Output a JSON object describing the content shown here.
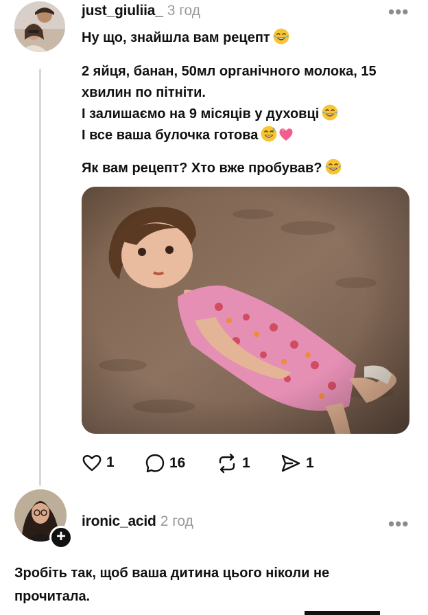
{
  "post": {
    "username": "just_giuliia_",
    "time": "3 год",
    "greeting": "Ну що, знайшла вам рецепт",
    "recipe_line_1": "2 яйця, банан, 50мл органічного молока, 15",
    "recipe_line_2": "хвилин по пітніти.",
    "recipe_line_3": "І залишаємо на 9 місяців у духовці",
    "recipe_line_4": "І все ваша булочка готова",
    "question": "Як вам рецепт? Хто вже пробував?",
    "likes": "1",
    "comments": "16",
    "reposts": "1",
    "shares": "1"
  },
  "reply": {
    "username": "ironic_acid",
    "time": "2 год",
    "text_line_1": "Зробіть так, щоб ваша дитина цього ніколи не",
    "text_line_2": "прочитала."
  },
  "icons": {
    "more": "more-horizontal-icon",
    "like": "heart-outline-icon",
    "comment": "speech-bubble-icon",
    "repost": "repost-arrows-icon",
    "share": "send-paper-plane-icon",
    "follow": "plus-icon",
    "emoji_laugh": "face-with-tears-of-joy-emoji",
    "emoji_sweat": "grinning-face-with-sweat-emoji",
    "emoji_heart": "pink-heart-emoji"
  },
  "colors": {
    "text": "#111111",
    "muted": "#9a9a9a",
    "thread_line": "#d6d6d6"
  }
}
